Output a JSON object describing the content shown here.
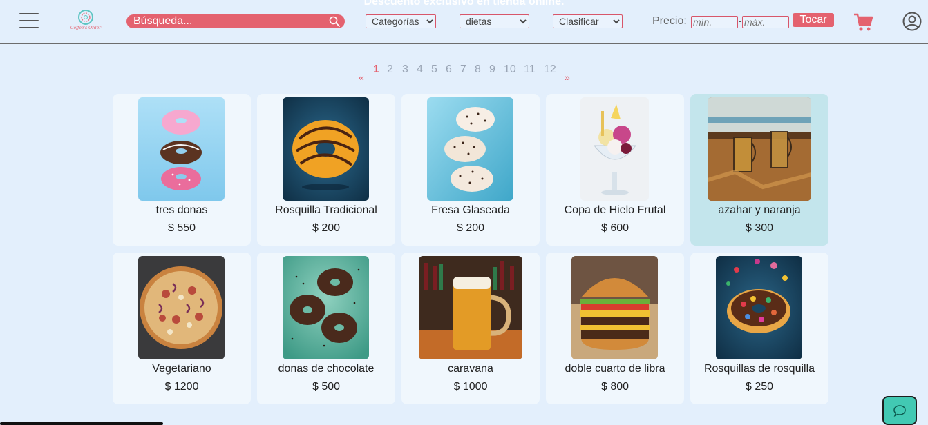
{
  "header": {
    "banner": "Descuento exclusivo en tienda online.",
    "logo_text": "Coffee's Order",
    "search_placeholder": "Búsqueda...",
    "filters": [
      {
        "name": "categories",
        "selected": "Categorías"
      },
      {
        "name": "diets",
        "selected": "dietas"
      },
      {
        "name": "sort",
        "selected": "Clasificar"
      }
    ],
    "price_label": "Precio:",
    "min_placeholder": "mín.",
    "max_placeholder": "máx.",
    "price_dash": "-",
    "apply_button": "Tocar"
  },
  "pagination": {
    "prev": "«",
    "next": "»",
    "pages": [
      "1",
      "2",
      "3",
      "4",
      "5",
      "6",
      "7",
      "8",
      "9",
      "10",
      "11",
      "12"
    ],
    "current": "1"
  },
  "products": [
    {
      "name": "tres donas",
      "price": "$ 550",
      "image": "three-donuts-image"
    },
    {
      "name": "Rosquilla Tradicional",
      "price": "$ 200",
      "image": "glazed-donut-image"
    },
    {
      "name": "Fresa Glaseada",
      "price": "$ 200",
      "image": "sprinkle-donuts-image"
    },
    {
      "name": "Copa de Hielo Frutal",
      "price": "$ 600",
      "image": "ice-cream-cup-image"
    },
    {
      "name": "azahar y naranja",
      "price": "$ 300",
      "image": "tea-glasses-image",
      "highlight": true
    },
    {
      "name": "Vegetariano",
      "price": "$ 1200",
      "image": "pizza-image"
    },
    {
      "name": "donas de chocolate",
      "price": "$ 500",
      "image": "chocolate-donuts-image"
    },
    {
      "name": "caravana",
      "price": "$ 1000",
      "image": "beer-mug-image"
    },
    {
      "name": "doble cuarto de libra",
      "price": "$ 800",
      "image": "burger-image"
    },
    {
      "name": "Rosquillas de rosquilla",
      "price": "$ 250",
      "image": "candy-donut-image"
    }
  ],
  "colors": {
    "accent": "#e4626f",
    "background": "#e3effc",
    "card": "#f0f7fd",
    "card_highlight": "#c3e5ec",
    "chat": "#42c9b3"
  }
}
